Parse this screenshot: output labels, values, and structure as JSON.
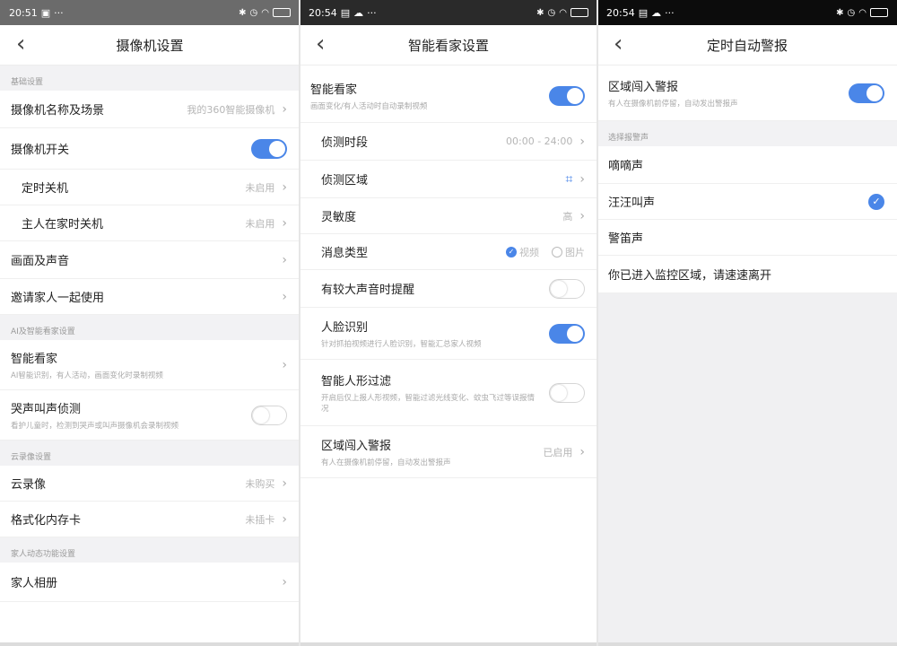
{
  "status": {
    "p1_time": "20:51",
    "p2_time": "20:54",
    "p3_time": "20:54",
    "dots": "···"
  },
  "screen1": {
    "title": "摄像机设置",
    "sections": {
      "basic": "基础设置",
      "ai": "AI及智能看家设置",
      "cloud": "云录像设置",
      "family": "家人动态功能设置"
    },
    "rows": {
      "name_scene": "摄像机名称及场景",
      "name_scene_value": "我的360智能摄像机",
      "camera_switch": "摄像机开关",
      "timer_off": "定时关机",
      "timer_off_value": "未启用",
      "home_off": "主人在家时关机",
      "home_off_value": "未启用",
      "picture_sound": "画面及声音",
      "invite_family": "邀请家人一起使用",
      "smart_guard": "智能看家",
      "smart_guard_desc": "AI智能识别，有人活动，画面变化时录制视频",
      "cry_detect": "哭声叫声侦测",
      "cry_detect_desc": "看护儿童时，检测到哭声或叫声摄像机会录制视频",
      "cloud_record": "云录像",
      "cloud_record_value": "未购买",
      "format_card": "格式化内存卡",
      "format_card_value": "未插卡",
      "family_album": "家人相册"
    }
  },
  "screen2": {
    "title": "智能看家设置",
    "rows": {
      "smart_guard": "智能看家",
      "smart_guard_desc": "画面变化/有人活动时自动录制视频",
      "period": "侦测时段",
      "period_value": "00:00 - 24:00",
      "area": "侦测区域",
      "sensitivity": "灵敏度",
      "sensitivity_value": "高",
      "msg_type": "消息类型",
      "msg_video": "视频",
      "msg_image": "图片",
      "loud_sound": "有较大声音时提醒",
      "face_recog": "人脸识别",
      "face_recog_desc": "针对抓拍视频进行人脸识别，智能汇总家人视频",
      "human_filter": "智能人形过滤",
      "human_filter_desc": "开启后仅上报人形视频，智能过滤光线变化、蚊虫飞过等误报情况",
      "intrusion_alarm": "区域闯入警报",
      "intrusion_alarm_desc": "有人在摄像机前停留，自动发出警报声",
      "intrusion_alarm_value": "已启用"
    }
  },
  "screen3": {
    "title": "定时自动警报",
    "rows": {
      "intrusion_alarm": "区域闯入警报",
      "intrusion_alarm_desc": "有人在摄像机前停留，自动发出警报声",
      "choose_sound": "选择报警声",
      "sound1": "嘀嘀声",
      "sound2": "汪汪叫声",
      "sound3": "警笛声",
      "sound4": "你已进入监控区域，请速速离开"
    }
  },
  "colors": {
    "accent": "#4a86e8",
    "section_bg": "#f2f2f4"
  }
}
